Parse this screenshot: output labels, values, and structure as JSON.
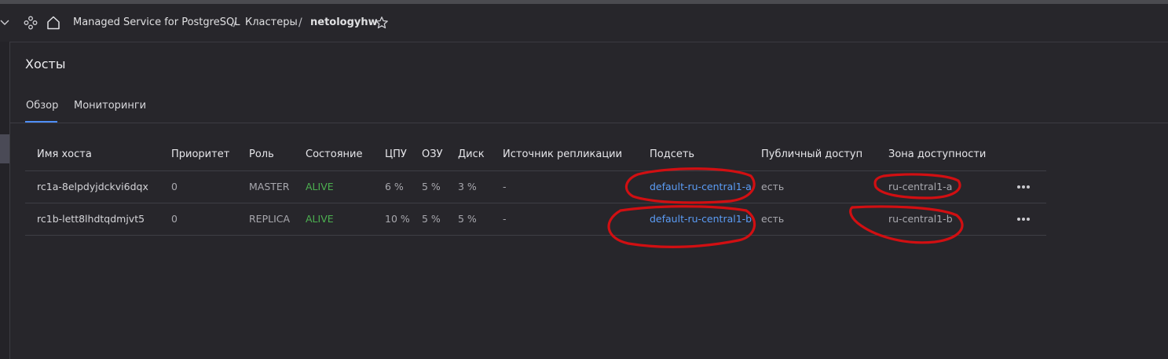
{
  "header": {
    "breadcrumbs": [
      "Managed Service for PostgreSQL",
      "Кластеры",
      "netologyhw"
    ],
    "separator": "/",
    "icons": [
      "chevron-down-icon",
      "cluster-icon",
      "home-icon",
      "star-icon"
    ]
  },
  "page": {
    "title": "Хосты",
    "tabs": [
      {
        "label": "Обзор",
        "active": true
      },
      {
        "label": "Мониторинги",
        "active": false
      }
    ]
  },
  "hosts_table": {
    "columns": [
      "Имя хоста",
      "Приоритет",
      "Роль",
      "Состояние",
      "ЦПУ",
      "ОЗУ",
      "Диск",
      "Источник репликации",
      "Подсеть",
      "Публичный доступ",
      "Зона доступности"
    ],
    "rows": [
      {
        "host": "rc1a-8elpdyjdckvi6dqx",
        "priority": "0",
        "role": "MASTER",
        "state": "ALIVE",
        "cpu": "6 %",
        "ram": "5 %",
        "disk": "3 %",
        "replication_source": "-",
        "subnet": "default-ru-central1-a",
        "public_access": "есть",
        "zone": "ru-central1-a"
      },
      {
        "host": "rc1b-lett8lhdtqdmjvt5",
        "priority": "0",
        "role": "REPLICA",
        "state": "ALIVE",
        "cpu": "10 %",
        "ram": "5 %",
        "disk": "5 %",
        "replication_source": "-",
        "subnet": "default-ru-central1-b",
        "public_access": "есть",
        "zone": "ru-central1-b"
      }
    ],
    "row_actions_icon": "more-horizontal-icon"
  },
  "colors": {
    "background": "#27262b",
    "accent_tab": "#4f8ef7",
    "alive": "#4caf50",
    "link": "#5b9cf5",
    "annotation": "#d10f12"
  }
}
